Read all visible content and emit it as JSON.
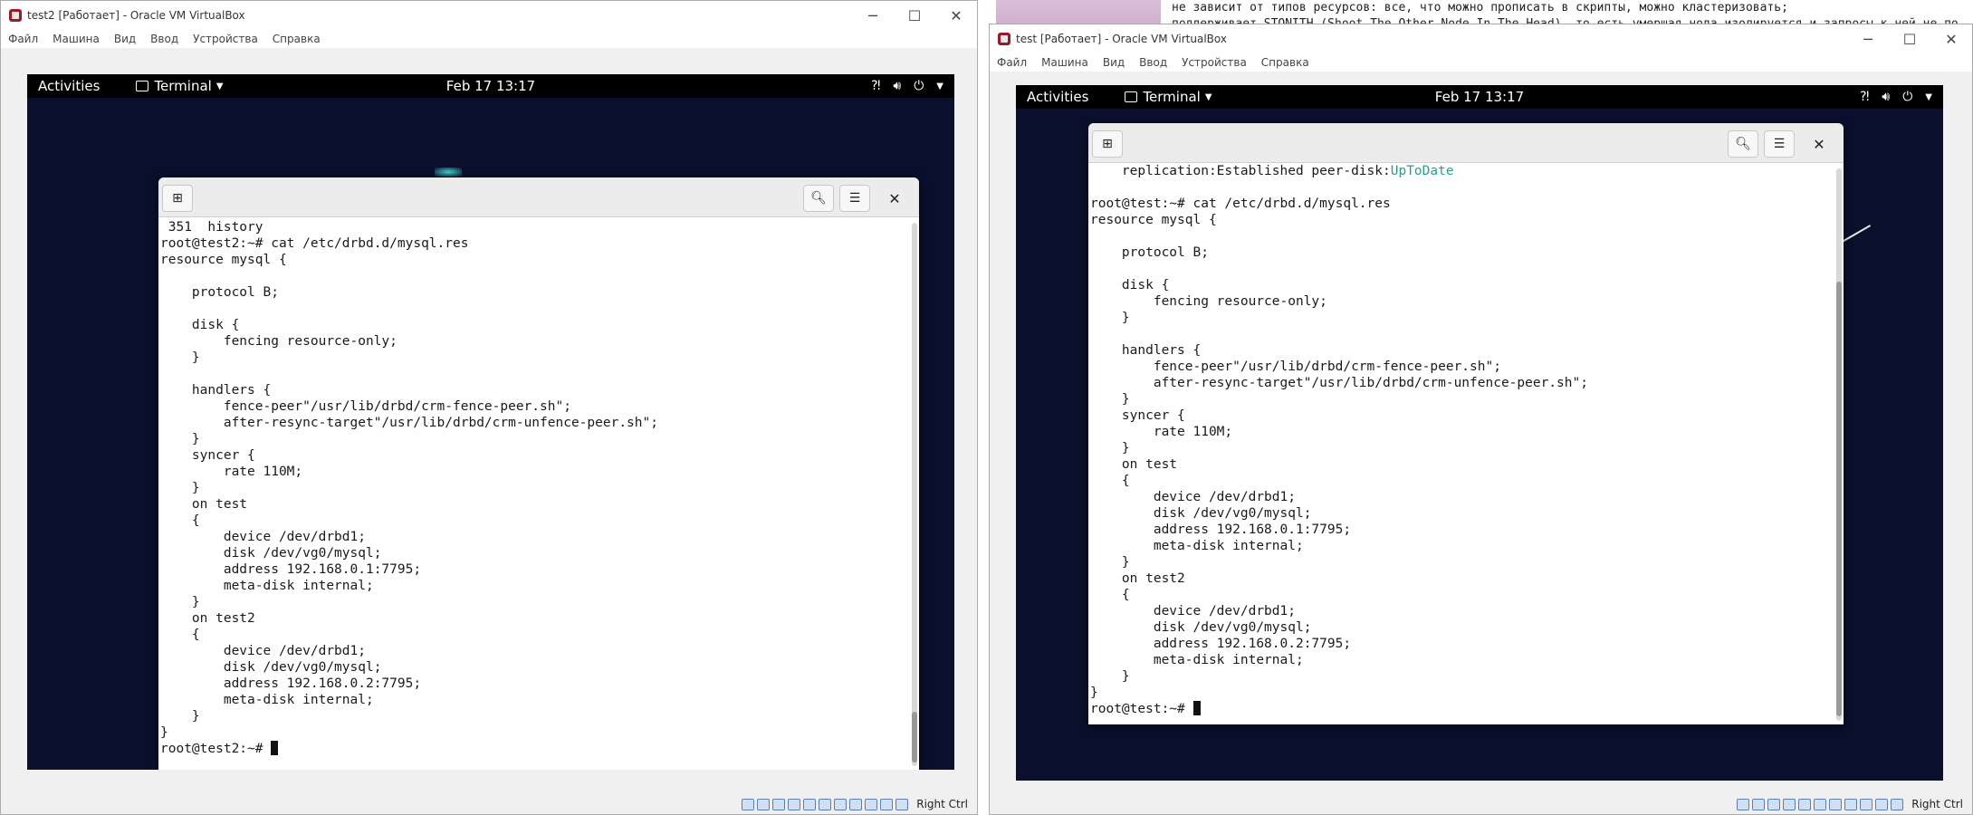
{
  "background_doc": {
    "line1": "не зависит от типов ресурсов: все, что можно прописать в скрипты, можно кластеризовать;",
    "line2": "поддерживает STONITH (Shoot-The-Other-Node-In-The-Head), то есть умершая нода изолируется и запросы к ней не по"
  },
  "left_vm": {
    "title": "test2 [Работает] - Oracle VM VirtualBox",
    "menu": [
      "Файл",
      "Машина",
      "Вид",
      "Ввод",
      "Устройства",
      "Справка"
    ],
    "gnome": {
      "activities": "Activities",
      "app": "Terminal",
      "clock": "Feb 17  13:17"
    },
    "terminal_lines": [
      " 351  history",
      "root@test2:~# cat /etc/drbd.d/mysql.res",
      "resource mysql {",
      "",
      "    protocol B;",
      "",
      "    disk {",
      "        fencing resource-only;",
      "    }",
      "",
      "    handlers {",
      "        fence-peer\"/usr/lib/drbd/crm-fence-peer.sh\";",
      "        after-resync-target\"/usr/lib/drbd/crm-unfence-peer.sh\";",
      "    }",
      "    syncer {",
      "        rate 110M;",
      "    }",
      "    on test",
      "    {",
      "        device /dev/drbd1;",
      "        disk /dev/vg0/mysql;",
      "        address 192.168.0.1:7795;",
      "        meta-disk internal;",
      "    }",
      "    on test2",
      "    {",
      "        device /dev/drbd1;",
      "        disk /dev/vg0/mysql;",
      "        address 192.168.0.2:7795;",
      "        meta-disk internal;",
      "    }",
      "}"
    ],
    "prompt": "root@test2:~# ",
    "status_host_key": "Right Ctrl"
  },
  "right_vm": {
    "title": "test [Работает] - Oracle VM VirtualBox",
    "menu": [
      "Файл",
      "Машина",
      "Вид",
      "Ввод",
      "Устройства",
      "Справка"
    ],
    "gnome": {
      "activities": "Activities",
      "app": "Terminal",
      "clock": "Feb 17  13:17"
    },
    "first_line_prefix": "    replication:Established peer-disk:",
    "first_line_highlight": "UpToDate",
    "terminal_lines": [
      "",
      "root@test:~# cat /etc/drbd.d/mysql.res",
      "resource mysql {",
      "",
      "    protocol B;",
      "",
      "    disk {",
      "        fencing resource-only;",
      "    }",
      "",
      "    handlers {",
      "        fence-peer\"/usr/lib/drbd/crm-fence-peer.sh\";",
      "        after-resync-target\"/usr/lib/drbd/crm-unfence-peer.sh\";",
      "    }",
      "    syncer {",
      "        rate 110M;",
      "    }",
      "    on test",
      "    {",
      "        device /dev/drbd1;",
      "        disk /dev/vg0/mysql;",
      "        address 192.168.0.1:7795;",
      "        meta-disk internal;",
      "    }",
      "    on test2",
      "    {",
      "        device /dev/drbd1;",
      "        disk /dev/vg0/mysql;",
      "        address 192.168.0.2:7795;",
      "        meta-disk internal;",
      "    }",
      "}"
    ],
    "prompt": "root@test:~# ",
    "status_host_key": "Right Ctrl"
  },
  "icons": {
    "new_tab": "new-tab-icon",
    "search": "search-icon",
    "menu": "hamburger-menu-icon",
    "close": "close-icon",
    "minimize": "minimize-icon",
    "maximize": "maximize-icon",
    "network": "network-icon",
    "volume": "volume-icon",
    "power": "power-icon"
  },
  "colors": {
    "desktop_bg": "#0a0f2c",
    "highlight": "#2a9c8e"
  }
}
